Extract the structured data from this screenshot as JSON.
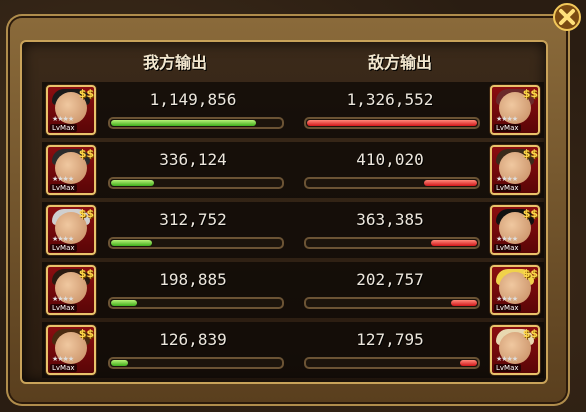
{
  "header": {
    "our_output": "我方输出",
    "enemy_output": "敌方输出"
  },
  "rows": [
    {
      "our_value": "1,149,856",
      "enemy_value": "1,326,552",
      "our_fill": 0.85,
      "enemy_fill": 1.0,
      "our_hero": {
        "lv": "LvMax"
      },
      "enemy_hero": {
        "lv": "LvMax"
      }
    },
    {
      "our_value": "336,124",
      "enemy_value": "410,020",
      "our_fill": 0.25,
      "enemy_fill": 0.31,
      "our_hero": {
        "lv": "LvMax"
      },
      "enemy_hero": {
        "lv": "LvMax"
      }
    },
    {
      "our_value": "312,752",
      "enemy_value": "363,385",
      "our_fill": 0.24,
      "enemy_fill": 0.27,
      "our_hero": {
        "lv": "LvMax"
      },
      "enemy_hero": {
        "lv": "LvMax"
      }
    },
    {
      "our_value": "198,885",
      "enemy_value": "202,757",
      "our_fill": 0.15,
      "enemy_fill": 0.15,
      "our_hero": {
        "lv": "LvMax"
      },
      "enemy_hero": {
        "lv": "LvMax"
      }
    },
    {
      "our_value": "126,839",
      "enemy_value": "127,795",
      "our_fill": 0.1,
      "enemy_fill": 0.1,
      "our_hero": {
        "lv": "LvMax"
      },
      "enemy_hero": {
        "lv": "LvMax"
      }
    }
  ],
  "colors": {
    "our_bar": "#4cc02a",
    "enemy_bar": "#d1161a",
    "frame": "#c9a35a"
  },
  "icons": {
    "close": "close-icon",
    "badge": "ss-rank-badge"
  }
}
